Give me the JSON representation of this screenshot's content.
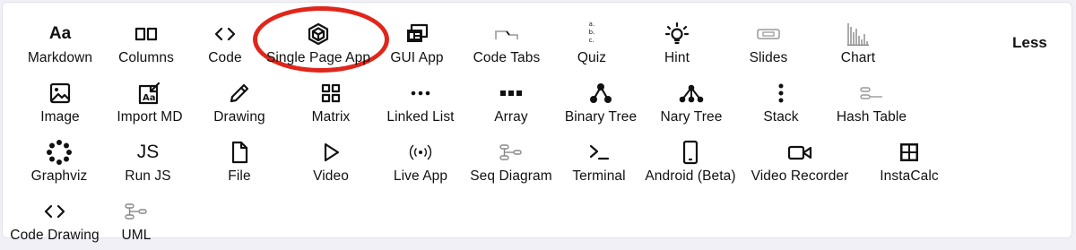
{
  "toolbar": {
    "less_label": "Less",
    "highlight_color": "#e0261b",
    "items": [
      {
        "id": "markdown",
        "label": "Markdown",
        "icon": "markdown-aa-icon",
        "icon_text": "Aa"
      },
      {
        "id": "columns",
        "label": "Columns",
        "icon": "columns-icon"
      },
      {
        "id": "code",
        "label": "Code",
        "icon": "code-brackets-icon"
      },
      {
        "id": "single-page-app",
        "label": "Single Page App",
        "icon": "cube-icon",
        "highlighted": true
      },
      {
        "id": "gui-app",
        "label": "GUI App",
        "icon": "gui-app-icon"
      },
      {
        "id": "code-tabs",
        "label": "Code Tabs",
        "icon": "code-tabs-icon"
      },
      {
        "id": "quiz",
        "label": "Quiz",
        "icon": "quiz-list-icon",
        "icon_lines": [
          "a.",
          "b.",
          "c."
        ]
      },
      {
        "id": "hint",
        "label": "Hint",
        "icon": "lightbulb-icon"
      },
      {
        "id": "slides",
        "label": "Slides",
        "icon": "slides-icon"
      },
      {
        "id": "chart",
        "label": "Chart",
        "icon": "chart-icon"
      },
      {
        "id": "image",
        "label": "Image",
        "icon": "image-icon"
      },
      {
        "id": "import-md",
        "label": "Import MD",
        "icon": "import-md-icon"
      },
      {
        "id": "drawing",
        "label": "Drawing",
        "icon": "pencil-icon"
      },
      {
        "id": "matrix",
        "label": "Matrix",
        "icon": "matrix-icon"
      },
      {
        "id": "linked-list",
        "label": "Linked List",
        "icon": "linked-list-icon"
      },
      {
        "id": "array",
        "label": "Array",
        "icon": "array-icon"
      },
      {
        "id": "binary-tree",
        "label": "Binary Tree",
        "icon": "binary-tree-icon"
      },
      {
        "id": "nary-tree",
        "label": "Nary Tree",
        "icon": "nary-tree-icon"
      },
      {
        "id": "stack",
        "label": "Stack",
        "icon": "stack-icon"
      },
      {
        "id": "hash-table",
        "label": "Hash Table",
        "icon": "hash-table-icon"
      },
      {
        "id": "graphviz",
        "label": "Graphviz",
        "icon": "graphviz-icon"
      },
      {
        "id": "run-js",
        "label": "Run JS",
        "icon": "js-icon",
        "icon_text": "JS"
      },
      {
        "id": "file",
        "label": "File",
        "icon": "file-icon"
      },
      {
        "id": "video",
        "label": "Video",
        "icon": "play-icon"
      },
      {
        "id": "live-app",
        "label": "Live App",
        "icon": "broadcast-icon"
      },
      {
        "id": "seq-diagram",
        "label": "Seq Diagram",
        "icon": "sequence-diagram-icon"
      },
      {
        "id": "terminal",
        "label": "Terminal",
        "icon": "terminal-icon"
      },
      {
        "id": "android",
        "label": "Android (Beta)",
        "icon": "phone-icon"
      },
      {
        "id": "video-recorder",
        "label": "Video Recorder",
        "icon": "video-camera-icon"
      },
      {
        "id": "instacalc",
        "label": "InstaCalc",
        "icon": "grid-calc-icon"
      },
      {
        "id": "code-drawing",
        "label": "Code Drawing",
        "icon": "code-brackets-icon"
      },
      {
        "id": "uml",
        "label": "UML",
        "icon": "uml-icon"
      }
    ]
  }
}
